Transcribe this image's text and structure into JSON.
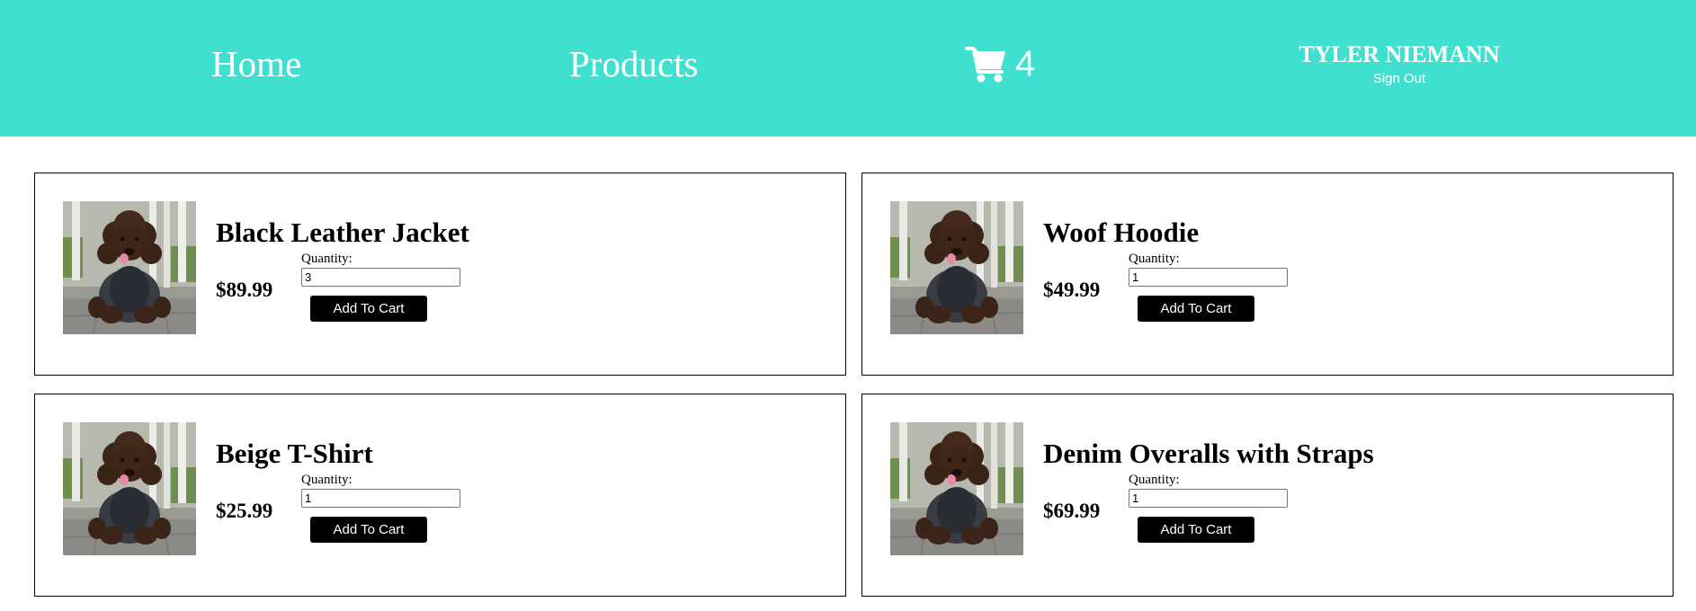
{
  "nav": {
    "home_label": "Home",
    "products_label": "Products",
    "cart_icon": "shopping-cart-icon",
    "cart_count": "4",
    "user_name": "TYLER NIEMANN",
    "signout_label": "Sign Out",
    "background_color": "#40e0d0"
  },
  "products": [
    {
      "name": "Black Leather Jacket",
      "price": "$89.99",
      "quantity_label": "Quantity:",
      "quantity": "3",
      "button_label": "Add To Cart",
      "image": "dog-in-jacket-photo"
    },
    {
      "name": "Woof Hoodie",
      "price": "$49.99",
      "quantity_label": "Quantity:",
      "quantity": "1",
      "button_label": "Add To Cart",
      "image": "dog-in-jacket-photo"
    },
    {
      "name": "Beige T-Shirt",
      "price": "$25.99",
      "quantity_label": "Quantity:",
      "quantity": "1",
      "button_label": "Add To Cart",
      "image": "dog-in-jacket-photo"
    },
    {
      "name": "Denim Overalls with Straps",
      "price": "$69.99",
      "quantity_label": "Quantity:",
      "quantity": "1",
      "button_label": "Add To Cart",
      "image": "dog-in-jacket-photo"
    }
  ]
}
